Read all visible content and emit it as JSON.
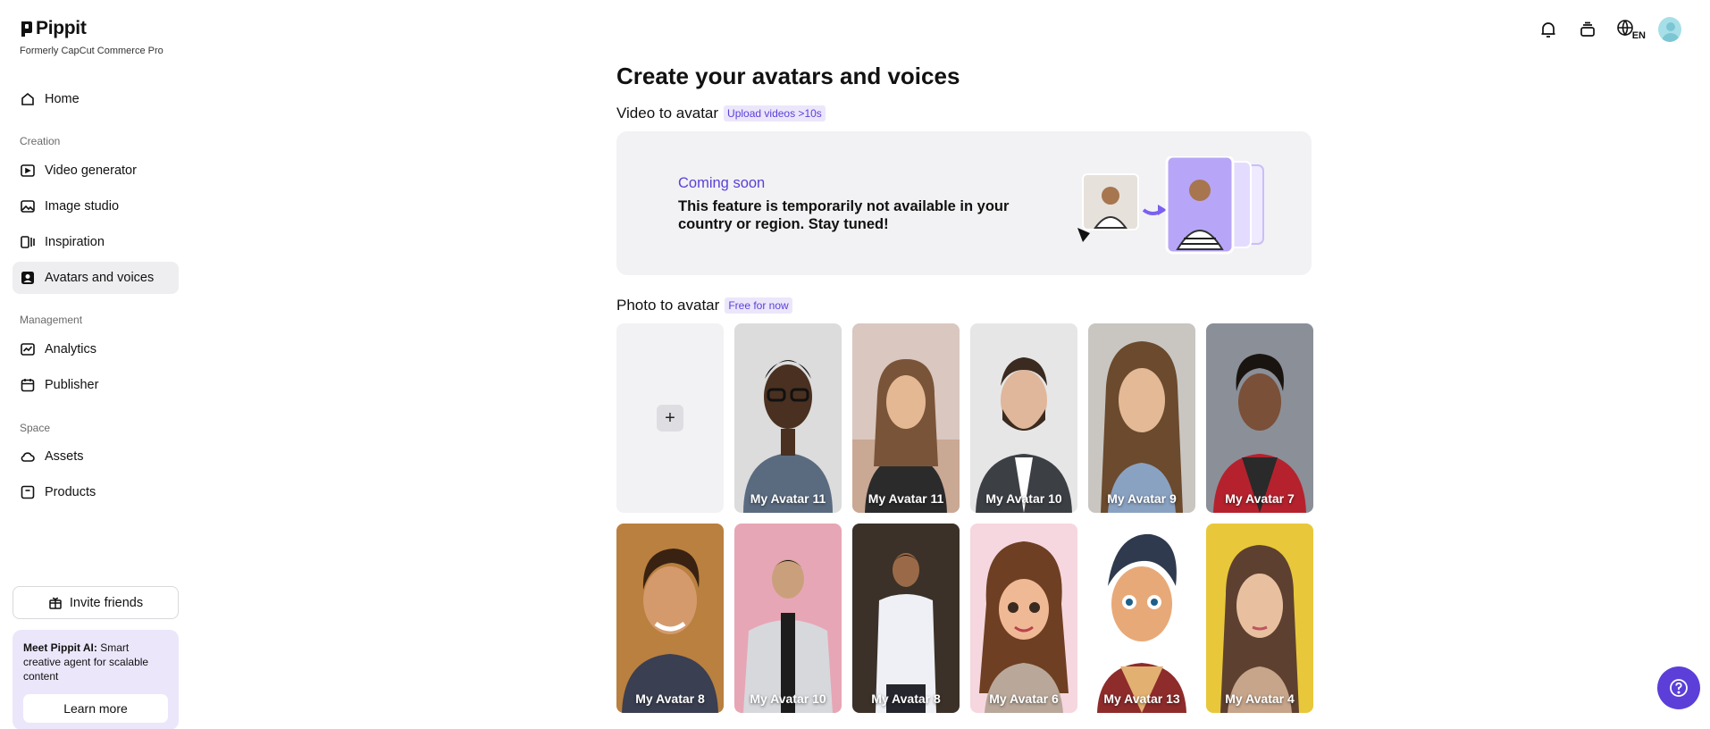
{
  "brand": {
    "name": "Pippit",
    "subtitle": "Formerly CapCut Commerce Pro"
  },
  "sidebar": {
    "home": "Home",
    "sections": [
      {
        "label": "Creation",
        "items": [
          "Video generator",
          "Image studio",
          "Inspiration",
          "Avatars and voices"
        ]
      },
      {
        "label": "Management",
        "items": [
          "Analytics",
          "Publisher"
        ]
      },
      {
        "label": "Space",
        "items": [
          "Assets",
          "Products"
        ]
      }
    ],
    "active_item": "Avatars and voices",
    "invite_label": "Invite friends",
    "promo": {
      "bold": "Meet Pippit AI:",
      "text": " Smart creative agent for scalable content",
      "button": "Learn more"
    }
  },
  "header": {
    "icons": [
      "bell-icon",
      "stack-icon",
      "language-icon",
      "user-avatar"
    ],
    "language": "EN"
  },
  "main": {
    "title": "Create your avatars and voices",
    "video_section": {
      "heading": "Video to avatar",
      "badge": "Upload videos >10s"
    },
    "coming_soon": {
      "title": "Coming soon",
      "text": "This feature is temporarily not available in your country or region. Stay tuned!"
    },
    "photo_section": {
      "heading": "Photo to avatar",
      "badge": "Free for now"
    },
    "avatars": [
      {
        "label": "My Avatar 11"
      },
      {
        "label": "My Avatar 11"
      },
      {
        "label": "My Avatar 10"
      },
      {
        "label": "My Avatar 9"
      },
      {
        "label": "My Avatar 7"
      },
      {
        "label": "My Avatar 8"
      },
      {
        "label": "My Avatar 10"
      },
      {
        "label": "My Avatar 8"
      },
      {
        "label": "My Avatar 6"
      },
      {
        "label": "My Avatar 13"
      },
      {
        "label": "My Avatar 4"
      }
    ]
  },
  "colors": {
    "accent": "#5b3fd8",
    "accent_soft": "#ece6fb",
    "card_bg": "#f2f2f4"
  }
}
